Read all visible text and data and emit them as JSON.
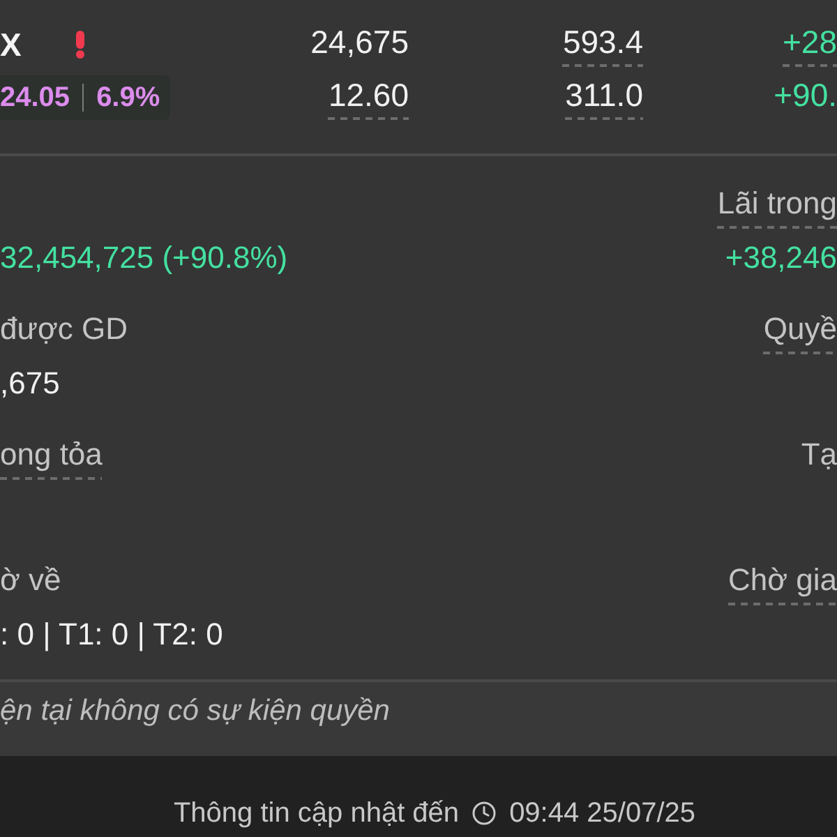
{
  "holding": {
    "rows": [
      {
        "kind": "symbol",
        "symbol": "X",
        "warning": true,
        "cells": [
          {
            "text": "24,675",
            "underlined": false,
            "positive": false
          },
          {
            "text": "593.4",
            "underlined": true,
            "positive": false
          },
          {
            "text": "+28",
            "underlined": true,
            "positive": true
          }
        ]
      },
      {
        "kind": "price",
        "price": "24.05",
        "change_percent": "6.9%",
        "at_ceiling": true,
        "cells": [
          {
            "text": "12.60",
            "underlined": true,
            "positive": false
          },
          {
            "text": "311.0",
            "underlined": true,
            "positive": false
          },
          {
            "text": "+90.",
            "underlined": false,
            "positive": true
          }
        ]
      }
    ]
  },
  "details": [
    {
      "left": {
        "value": {
          "text": "32,454,725 (+90.8%)",
          "positive": true
        }
      },
      "right": {
        "label": {
          "text": "Lãi trong",
          "underlined": true
        },
        "value": {
          "text": "+38,246",
          "positive": true
        }
      }
    },
    {
      "left": {
        "label": {
          "text": "được GD",
          "underlined": false
        },
        "value": {
          "text": ",675",
          "positive": false
        }
      },
      "right": {
        "label": {
          "text": "Quyề",
          "underlined": true
        }
      }
    },
    {
      "left": {
        "label": {
          "text": "ong tỏa",
          "underlined": true
        }
      },
      "right": {
        "label": {
          "text": "Tạ",
          "underlined": false
        }
      }
    },
    {
      "left": {
        "label": {
          "text": "ờ về",
          "underlined": false
        },
        "value": {
          "text": ": 0 | T1: 0 | T2: 0",
          "positive": false
        }
      },
      "right": {
        "label": {
          "text": "Chờ gia",
          "underlined": true
        }
      }
    }
  ],
  "rights_notice": "ện tại không có sự kiện quyền",
  "footer": {
    "label": "Thông tin cập nhật đến",
    "timestamp": "09:44 25/07/25"
  }
}
